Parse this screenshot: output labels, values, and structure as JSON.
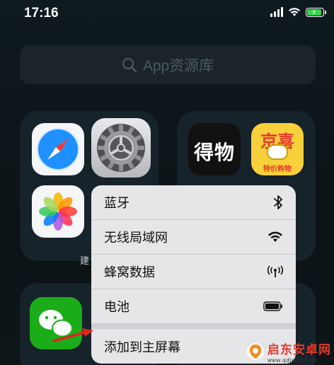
{
  "status_bar": {
    "time": "17:16",
    "battery_color": "#32d74b"
  },
  "search": {
    "placeholder": "App资源库",
    "icon": "search-icon"
  },
  "folders": {
    "caption_partial": "建"
  },
  "settings_app": {
    "icon": "gear-icon"
  },
  "apps_right": {
    "dewu_label": "得物",
    "jingxi_label": "京喜",
    "jingxi_sub": "特价购物"
  },
  "menu": {
    "items": [
      {
        "label": "蓝牙",
        "icon": "bluetooth-icon"
      },
      {
        "label": "无线局域网",
        "icon": "wifi-icon"
      },
      {
        "label": "蜂窝数据",
        "icon": "cellular-icon"
      },
      {
        "label": "电池",
        "icon": "battery-icon"
      }
    ],
    "add_to_home": "添加到主屏幕"
  },
  "annotation": {
    "arrow_color": "#e0241b"
  },
  "watermark": {
    "text": "启东安卓网",
    "url": "www.qdtaiao.com"
  }
}
